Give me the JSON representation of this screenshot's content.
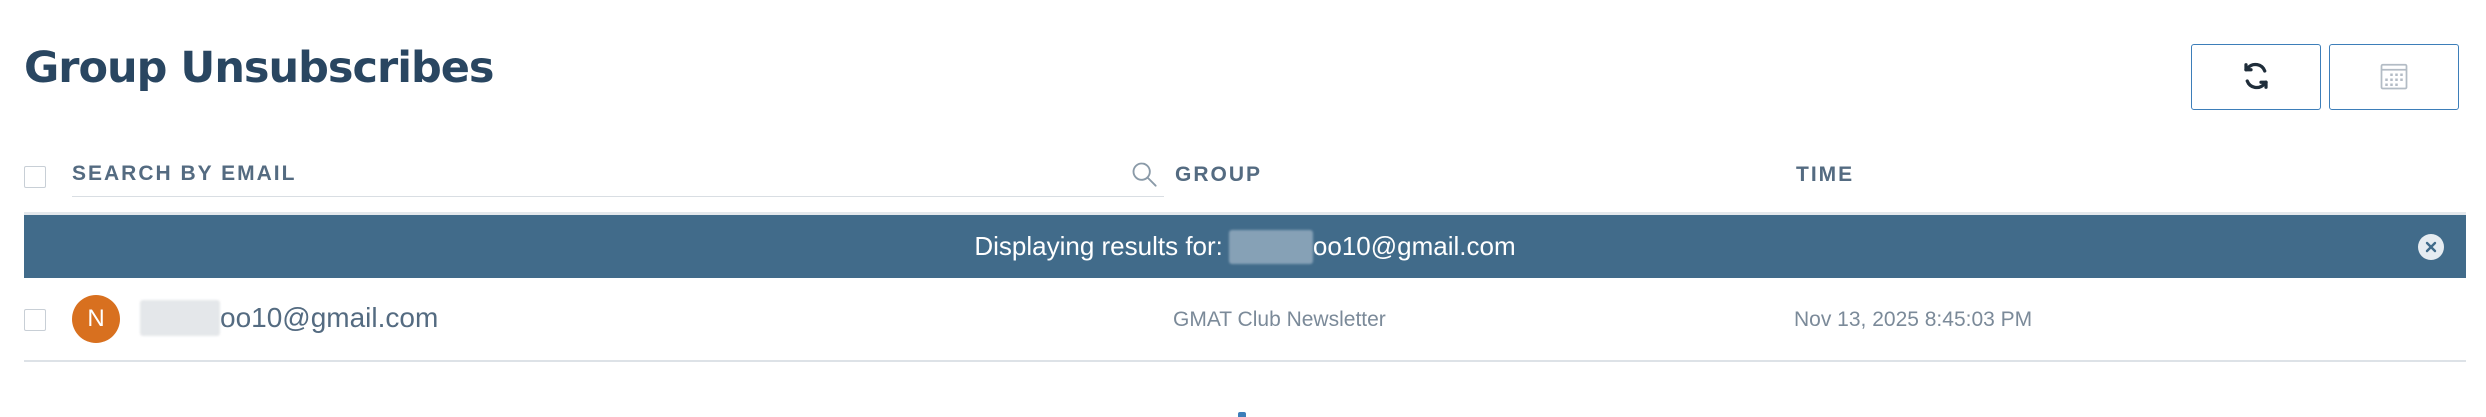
{
  "page": {
    "title": "Group Unsubscribes"
  },
  "toolbar": {
    "refresh_icon": "refresh-icon",
    "calendar_icon": "calendar-icon"
  },
  "search": {
    "placeholder": "SEARCH BY EMAIL",
    "value": ""
  },
  "columns": {
    "group": "GROUP",
    "time": "TIME"
  },
  "banner": {
    "prefix": "Displaying results for:",
    "email_suffix": "oo10@gmail.com"
  },
  "rows": [
    {
      "avatar_initial": "N",
      "email_suffix": "oo10@gmail.com",
      "group": "GMAT Club Newsletter",
      "time": "Nov 13, 2025 8:45:03 PM"
    }
  ],
  "colors": {
    "title": "#294661",
    "banner_bg": "#416b8a",
    "accent_border": "#3d7eb9",
    "avatar_bg": "#d8701f"
  }
}
